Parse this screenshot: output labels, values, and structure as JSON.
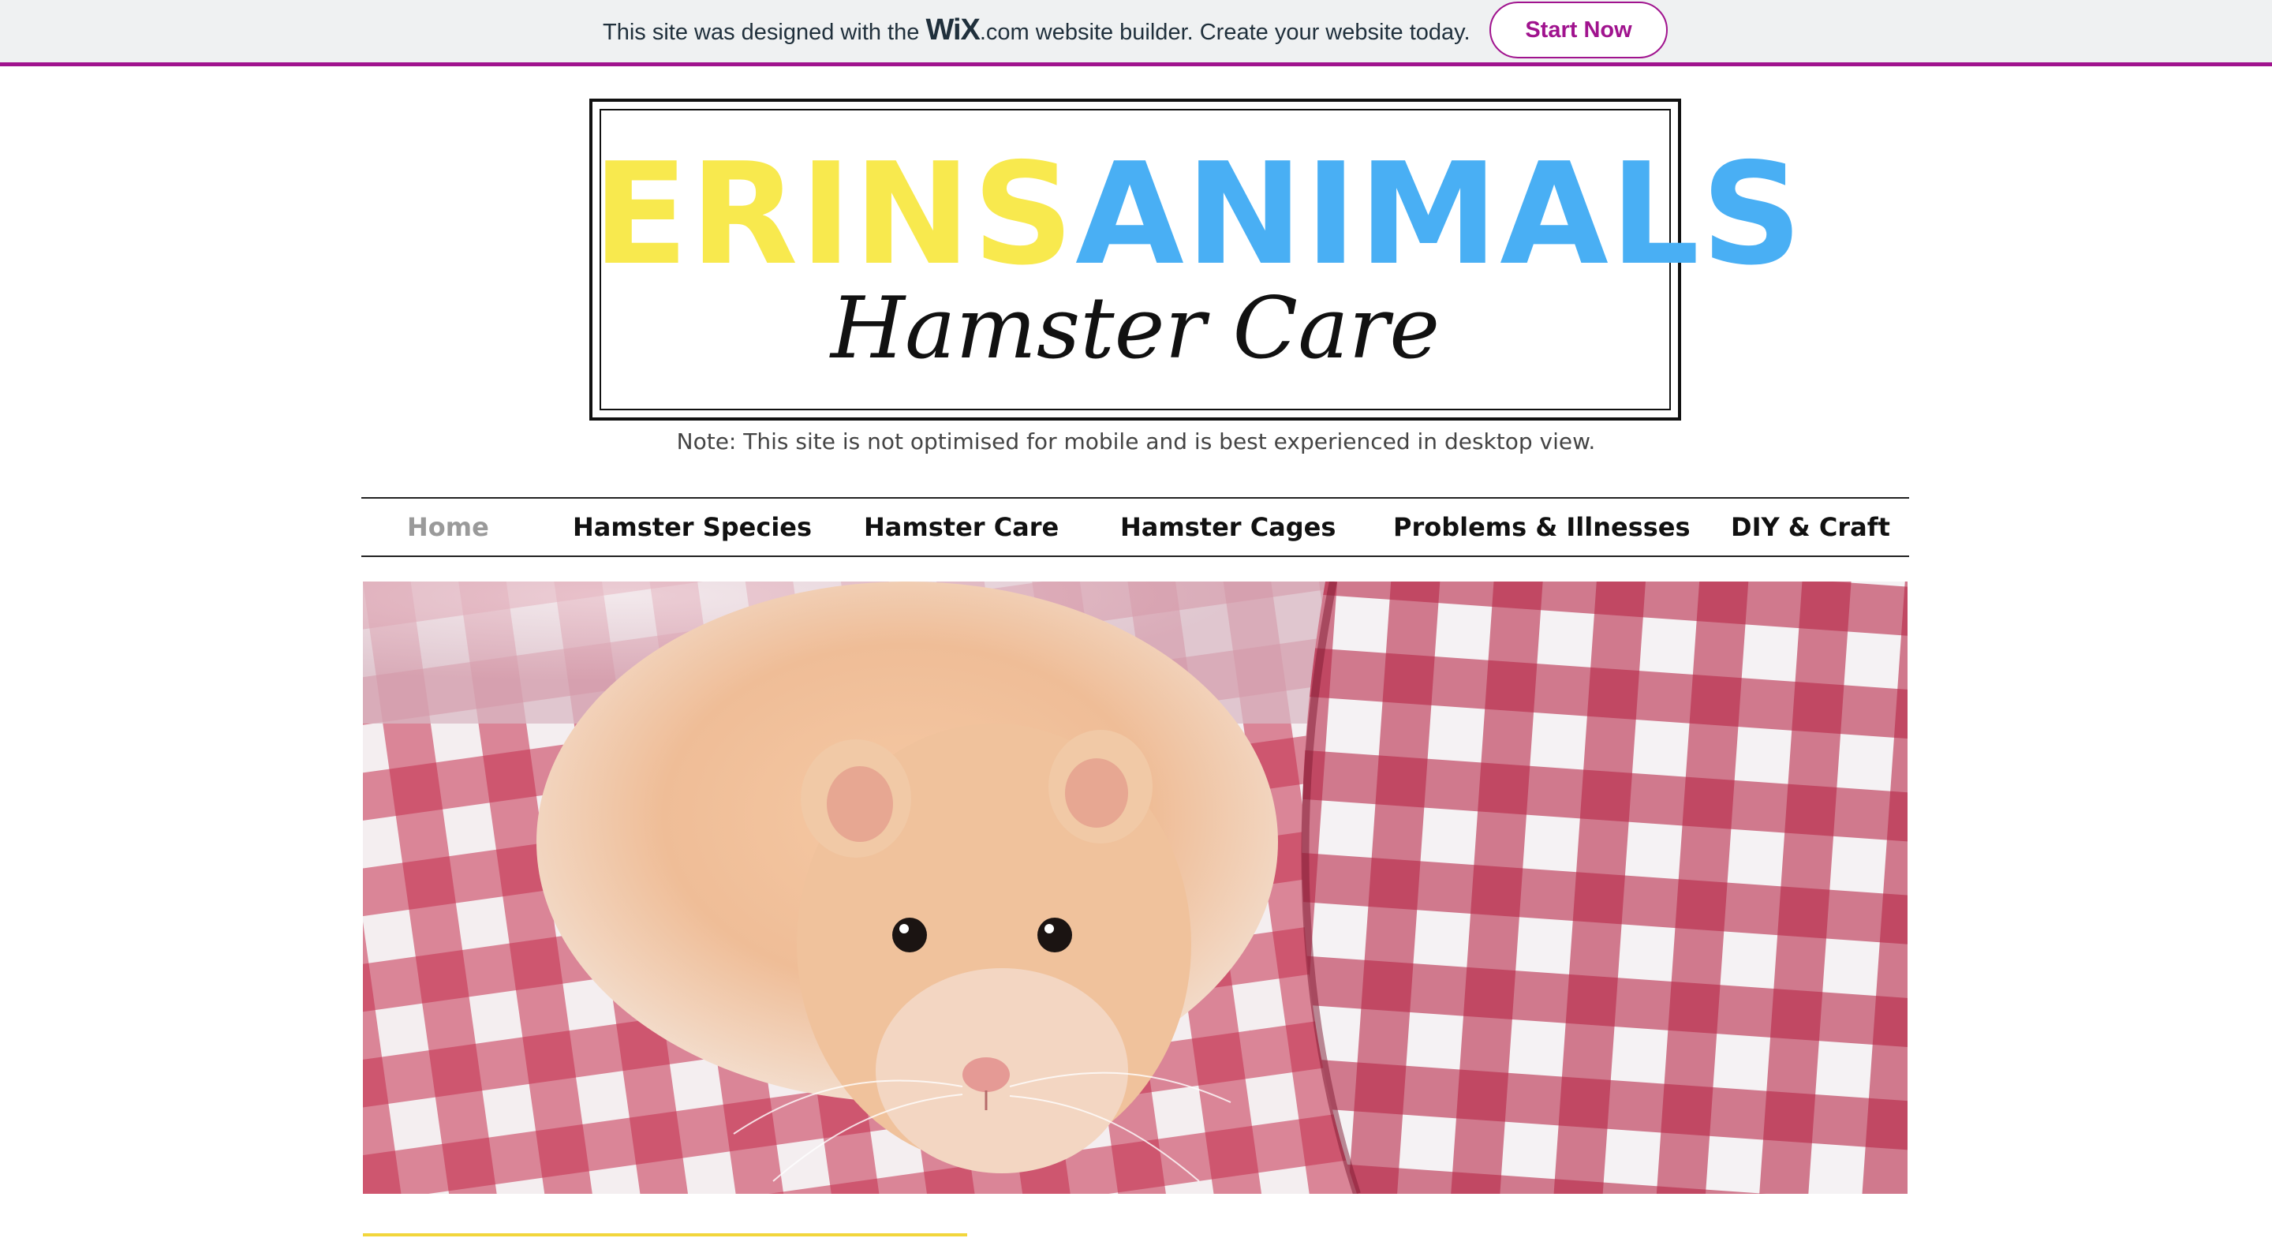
{
  "banner": {
    "text_before": "This site was designed with the",
    "logo": "WiX",
    "dotcom": ".com",
    "text_after": "website builder. Create your website today.",
    "cta_label": "Start Now",
    "accent_color": "#a0138e"
  },
  "logo": {
    "title_part1": "ERINS",
    "title_part2": "ANIMALS",
    "subtitle": "Hamster Care",
    "color_part1": "#f8e94e",
    "color_part2": "#49aff4"
  },
  "note": "Note: This site is not optimised for mobile and is best experienced in desktop view.",
  "nav": {
    "items": [
      {
        "label": "Home",
        "active": true
      },
      {
        "label": "Hamster Species",
        "active": false
      },
      {
        "label": "Hamster Care",
        "active": false
      },
      {
        "label": "Hamster Cages",
        "active": false
      },
      {
        "label": "Problems & Illnesses",
        "active": false
      },
      {
        "label": "DIY & Craft",
        "active": false
      }
    ]
  },
  "hero": {
    "image_subject": "hamster-on-gingham-cloth"
  }
}
